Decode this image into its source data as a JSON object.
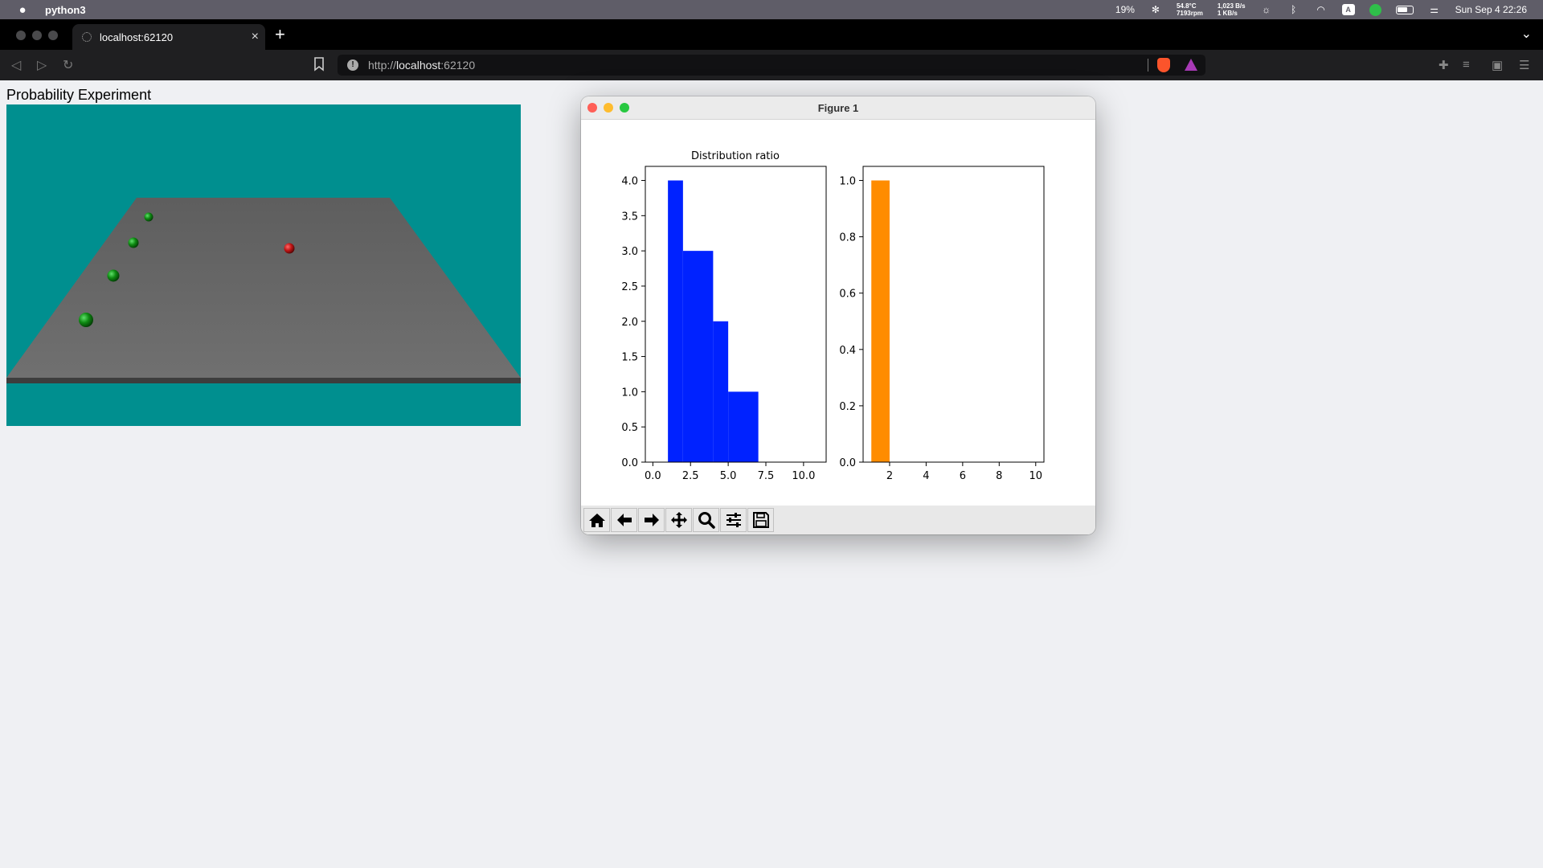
{
  "menubar": {
    "app_name": "python3",
    "battery_pct": "19%",
    "cpu_temp": "54.8°C",
    "fan_speed": "7193rpm",
    "net_up": "1,023 B/s",
    "net_down": "1 KB/s",
    "input_source": "A",
    "datetime": "Sun Sep 4  22:26"
  },
  "browser": {
    "tab_title": "localhost:62120",
    "url_scheme": "http://",
    "url_host": "localhost",
    "url_port": ":62120"
  },
  "page": {
    "title": "Probability Experiment",
    "scene": {
      "background": "#008f8f",
      "board_color": "#6b6b6b",
      "green_ball_color": "#0e8a12",
      "red_ball_color": "#c41616"
    }
  },
  "figure": {
    "window_title": "Figure 1",
    "toolbar": [
      "home-icon",
      "back-icon",
      "forward-icon",
      "pan-icon",
      "zoom-icon",
      "configure-icon",
      "save-icon"
    ]
  },
  "chart_data": [
    {
      "type": "bar",
      "title": "Distribution ratio",
      "color": "#0022ff",
      "bars": [
        {
          "x0": 1.0,
          "x1": 2.0,
          "value": 4.0
        },
        {
          "x0": 2.0,
          "x1": 4.0,
          "value": 3.0
        },
        {
          "x0": 4.0,
          "x1": 5.0,
          "value": 2.0
        },
        {
          "x0": 5.0,
          "x1": 7.0,
          "value": 1.0
        }
      ],
      "xlim": [
        -0.5,
        11.5
      ],
      "ylim": [
        0,
        4.2
      ],
      "xticks": [
        "0.0",
        "2.5",
        "5.0",
        "7.5",
        "10.0"
      ],
      "xtick_values": [
        0,
        2.5,
        5,
        7.5,
        10
      ],
      "yticks": [
        "0.0",
        "0.5",
        "1.0",
        "1.5",
        "2.0",
        "2.5",
        "3.0",
        "3.5",
        "4.0"
      ],
      "ytick_values": [
        0,
        0.5,
        1,
        1.5,
        2,
        2.5,
        3,
        3.5,
        4
      ]
    },
    {
      "type": "bar",
      "title": "",
      "color": "#ff8c00",
      "bars": [
        {
          "x0": 1.0,
          "x1": 2.0,
          "value": 1.0
        }
      ],
      "xlim": [
        0.55,
        10.45
      ],
      "ylim": [
        0,
        1.05
      ],
      "xticks": [
        "2",
        "4",
        "6",
        "8",
        "10"
      ],
      "xtick_values": [
        2,
        4,
        6,
        8,
        10
      ],
      "yticks": [
        "0.0",
        "0.2",
        "0.4",
        "0.6",
        "0.8",
        "1.0"
      ],
      "ytick_values": [
        0,
        0.2,
        0.4,
        0.6,
        0.8,
        1.0
      ]
    }
  ]
}
